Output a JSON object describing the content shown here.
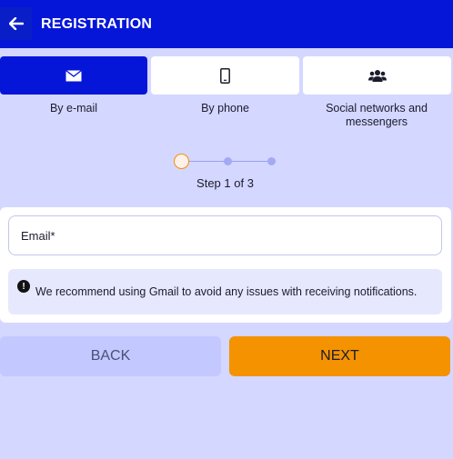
{
  "header": {
    "title": "REGISTRATION",
    "back_icon": "arrow-left-icon"
  },
  "tabs": [
    {
      "label": "By e-mail",
      "icon": "envelope-icon",
      "active": true
    },
    {
      "label": "By phone",
      "icon": "smartphone-icon",
      "active": false
    },
    {
      "label": "Social networks and messengers",
      "icon": "users-icon",
      "active": false
    }
  ],
  "stepper": {
    "text": "Step 1 of 3",
    "current": 1,
    "total": 3
  },
  "form": {
    "email_placeholder": "Email*"
  },
  "notice": {
    "icon": "exclamation-icon",
    "text": "We recommend using Gmail to avoid any issues with receiving notifications."
  },
  "buttons": {
    "back_label": "BACK",
    "next_label": "NEXT"
  },
  "colors": {
    "background": "#d4d7ff",
    "primary": "#0616d8",
    "accent": "#f49200",
    "secondary_button": "#c3c8ff"
  }
}
